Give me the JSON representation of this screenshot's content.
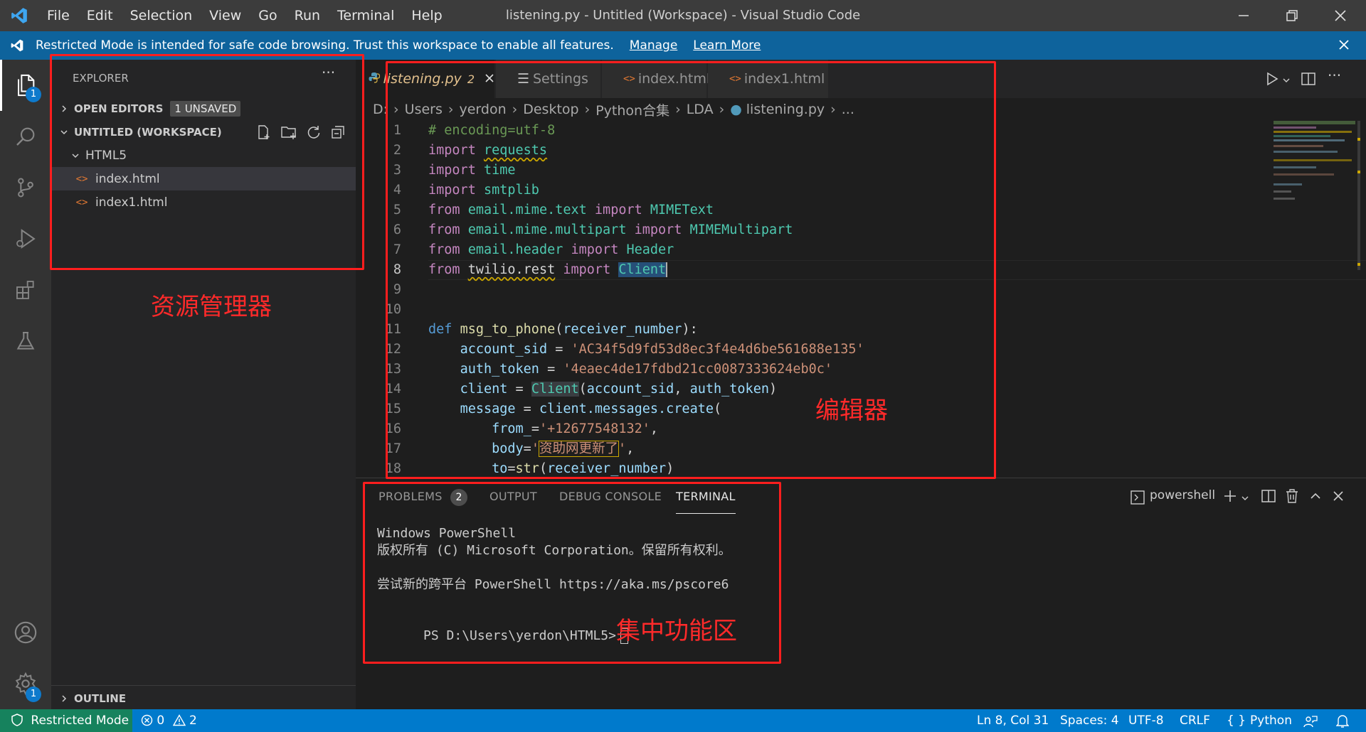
{
  "titlebar": {
    "menu": [
      "File",
      "Edit",
      "Selection",
      "View",
      "Go",
      "Run",
      "Terminal",
      "Help"
    ],
    "title": "listening.py - Untitled (Workspace) - Visual Studio Code"
  },
  "banner": {
    "message": "Restricted Mode is intended for safe code browsing. Trust this workspace to enable all features.",
    "manage": "Manage",
    "learn_more": "Learn More"
  },
  "activity": {
    "explorer_badge": "1",
    "settings_badge": "1"
  },
  "sidebar": {
    "title": "EXPLORER",
    "more": "···",
    "open_editors": "OPEN EDITORS",
    "unsaved_badge": "1 UNSAVED",
    "workspace": "UNTITLED (WORKSPACE)",
    "folder": "HTML5",
    "files": [
      "index.html",
      "index1.html"
    ],
    "outline": "OUTLINE"
  },
  "tabs": [
    {
      "label": "listening.py",
      "problems": "2"
    },
    {
      "label": "Settings"
    },
    {
      "label": "index.html"
    },
    {
      "label": "index1.html"
    }
  ],
  "breadcrumb": [
    "D:",
    "Users",
    "yerdon",
    "Desktop",
    "Python合集",
    "LDA",
    "listening.py",
    "..."
  ],
  "code": {
    "l1": "# encoding=utf-8",
    "requests": "requests",
    "time": "time",
    "smtplib": "smtplib",
    "email_text": "email.mime.text",
    "MIMEText": "MIMEText",
    "email_multi": "email.mime.multipart",
    "MIMEMultipart": "MIMEMultipart",
    "email_header": "email.header",
    "Header": "Header",
    "twilio": "twilio.rest",
    "Client": "Client",
    "msg_fn": "msg_to_phone",
    "param": "receiver_number",
    "sid_var": "account_sid",
    "sid_val": "'AC34f5d9fd53d8ec3f4e4d6be561688e135'",
    "tok_var": "auth_token",
    "tok_val": "'4eaec4de17fdbd21cc0087333624eb0c'",
    "client_var": "client",
    "message_var": "message",
    "create_call": "client.messages.create",
    "from_arg": "from_",
    "from_val": "'+12677548132'",
    "body_arg": "body",
    "body_val": "资助网更新了",
    "to_arg": "to",
    "str_fn": "str"
  },
  "panel": {
    "tabs": [
      "PROBLEMS",
      "OUTPUT",
      "DEBUG CONSOLE",
      "TERMINAL"
    ],
    "problems_count": "2",
    "shell": "powershell",
    "terminal_lines": [
      "Windows PowerShell",
      "版权所有 (C) Microsoft Corporation。保留所有权利。",
      "",
      "尝试新的跨平台 PowerShell https://aka.ms/pscore6",
      "",
      "PS D:\\Users\\yerdon\\HTML5>"
    ]
  },
  "statusbar": {
    "restricted": "Restricted Mode",
    "errors": "0",
    "warnings": "2",
    "position": "Ln 8, Col 31",
    "spaces": "Spaces: 4",
    "encoding": "UTF-8",
    "eol": "CRLF",
    "language": "Python"
  },
  "annotations": {
    "explorer": "资源管理器",
    "editor": "编辑器",
    "panel": "集中功能区"
  },
  "colors": {
    "accent": "#007acc",
    "annotation": "#ff1e1e",
    "banner": "#0e639c"
  }
}
